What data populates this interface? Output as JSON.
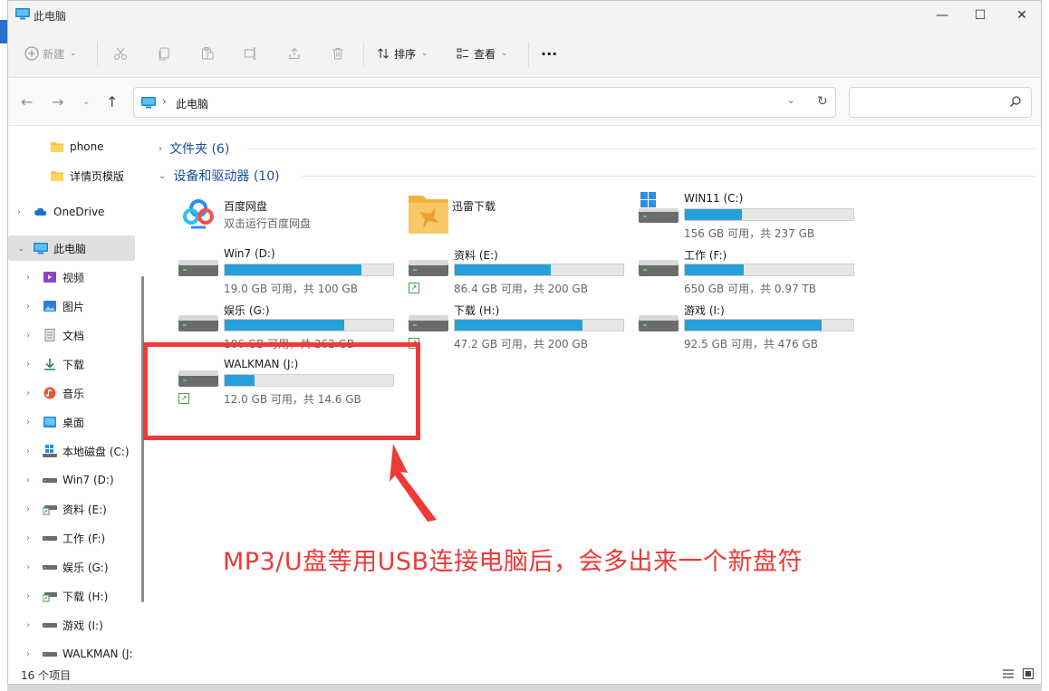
{
  "window": {
    "title": "此电脑",
    "minimize_glyph": "—",
    "maximize_glyph": "☐",
    "close_glyph": "✕"
  },
  "toolbar": {
    "new_label": "新建",
    "sort_label": "排序",
    "view_label": "查看",
    "more_label": "···"
  },
  "address": {
    "path": "此电脑",
    "search_placeholder": ""
  },
  "sidebar": {
    "items": [
      {
        "label": "phone",
        "icon": "folder-icon",
        "chevron": ""
      },
      {
        "label": "详情页模版",
        "icon": "folder-icon",
        "chevron": ""
      },
      {
        "label": "OneDrive",
        "icon": "cloud-icon",
        "chevron": "›"
      },
      {
        "label": "此电脑",
        "icon": "monitor-icon",
        "chevron": "⌄"
      },
      {
        "label": "视频",
        "icon": "video-icon",
        "chevron": "›"
      },
      {
        "label": "图片",
        "icon": "picture-icon",
        "chevron": "›"
      },
      {
        "label": "文档",
        "icon": "document-icon",
        "chevron": "›"
      },
      {
        "label": "下载",
        "icon": "download-icon",
        "chevron": "›"
      },
      {
        "label": "音乐",
        "icon": "music-icon",
        "chevron": "›"
      },
      {
        "label": "桌面",
        "icon": "desktop-icon",
        "chevron": "›"
      },
      {
        "label": "本地磁盘 (C:)",
        "icon": "windows-drive-icon",
        "chevron": "›"
      },
      {
        "label": "Win7 (D:)",
        "icon": "drive-icon",
        "chevron": "›"
      },
      {
        "label": "资料 (E:)",
        "icon": "network-drive-icon",
        "chevron": "›"
      },
      {
        "label": "工作 (F:)",
        "icon": "drive-icon",
        "chevron": "›"
      },
      {
        "label": "娱乐 (G:)",
        "icon": "drive-icon",
        "chevron": "›"
      },
      {
        "label": "下载 (H:)",
        "icon": "network-drive-icon",
        "chevron": "›"
      },
      {
        "label": "游戏 (I:)",
        "icon": "drive-icon",
        "chevron": "›"
      },
      {
        "label": "WALKMAN (J:",
        "icon": "drive-icon",
        "chevron": "›"
      }
    ]
  },
  "content": {
    "folders_header": "文件夹 (6)",
    "devices_header": "设备和驱动器 (10)",
    "apps": [
      {
        "name": "百度网盘",
        "sub": "双击运行百度网盘",
        "icon": "baidu-netdisk-icon"
      },
      {
        "name": "迅雷下载",
        "sub": "",
        "icon": "xunlei-folder-icon"
      }
    ],
    "drives": [
      {
        "name": "WIN11 (C:)",
        "space": "156 GB 可用，共 237 GB",
        "used": 0.34,
        "icon": "windows-drive-icon",
        "shortcut": false
      },
      {
        "name": "Win7 (D:)",
        "space": "19.0 GB 可用，共 100 GB",
        "used": 0.81,
        "icon": "drive-icon",
        "shortcut": false
      },
      {
        "name": "资料 (E:)",
        "space": "86.4 GB 可用，共 200 GB",
        "used": 0.57,
        "icon": "drive-icon",
        "shortcut": true
      },
      {
        "name": "工作 (F:)",
        "space": "650 GB 可用，共 0.97 TB",
        "used": 0.35,
        "icon": "drive-icon",
        "shortcut": false
      },
      {
        "name": "娱乐 (G:)",
        "space": "106 GB 可用，共 262 GB",
        "used": 0.71,
        "icon": "drive-icon",
        "shortcut": false
      },
      {
        "name": "下载 (H:)",
        "space": "47.2 GB 可用，共 200 GB",
        "used": 0.76,
        "icon": "drive-icon",
        "shortcut": true
      },
      {
        "name": "游戏 (I:)",
        "space": "92.5 GB 可用，共 476 GB",
        "used": 0.81,
        "icon": "drive-icon",
        "shortcut": false
      },
      {
        "name": "WALKMAN (J:)",
        "space": "12.0 GB 可用，共 14.6 GB",
        "used": 0.18,
        "icon": "drive-icon",
        "shortcut": true
      }
    ]
  },
  "status": {
    "count": "16 个项目"
  },
  "annotation": {
    "text": "MP3/U盘等用USB连接电脑后，会多出来一个新盘符",
    "color": "#ef3a37"
  },
  "colors": {
    "accent": "#26a0da",
    "group_header": "#1b4ea0"
  }
}
